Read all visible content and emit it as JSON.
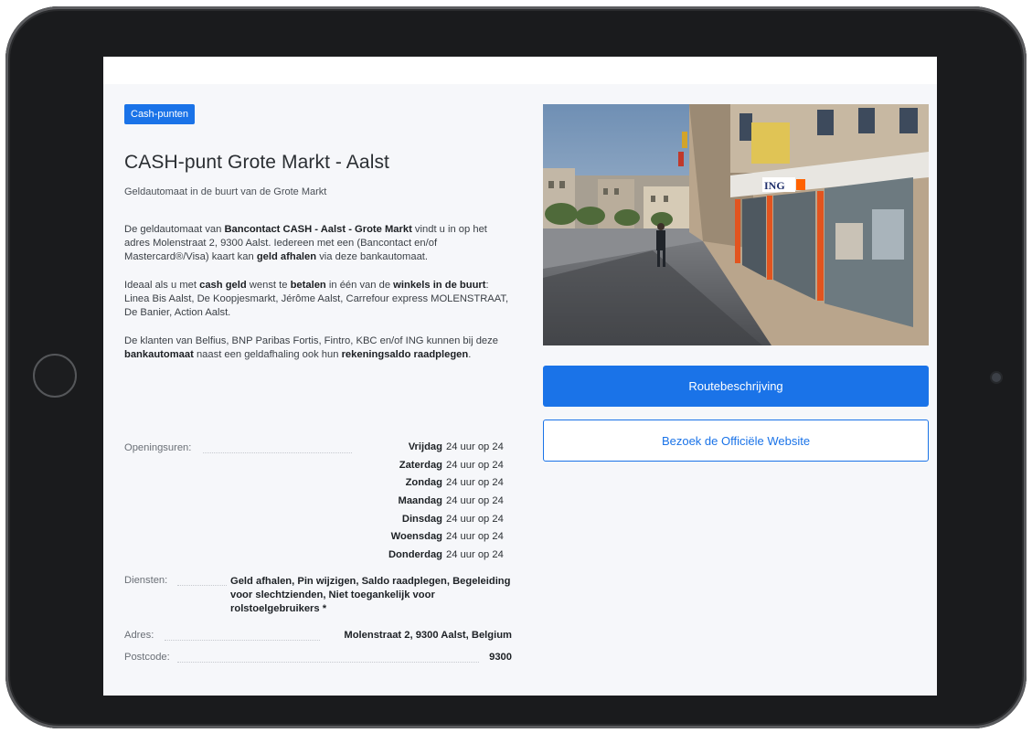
{
  "category_badge": "Cash-punten",
  "title": "CASH-punt Grote Markt - Aalst",
  "subtitle": "Geldautomaat in de buurt van de Grote Markt",
  "paragraphs": {
    "p1": {
      "a": "De geldautomaat van ",
      "b1": "Bancontact CASH - Aalst - Grote Markt",
      "c": " vindt u in op het adres Molenstraat 2, 9300 Aalst. Iedereen met een (Bancontact en/of Mastercard®/Visa) kaart kan ",
      "b2": "geld afhalen",
      "d": " via deze bankautomaat."
    },
    "p2": {
      "a": "Ideaal als u met ",
      "b1": "cash geld",
      "c": " wenst te ",
      "b2": "betalen",
      "d": " in één van de ",
      "b3": "winkels in de buurt",
      "e": ": Linea Bis Aalst, De Koopjesmarkt, Jérôme Aalst, Carrefour express MOLENSTRAAT, De Banier, Action Aalst."
    },
    "p3": {
      "a": "De klanten van Belfius, BNP Paribas Fortis, Fintro, KBC en/of ING kunnen bij deze ",
      "b1": "bankautomaat",
      "c": " naast een geldafhaling ook hun ",
      "b2": "rekeningsaldo raadplegen",
      "d": "."
    }
  },
  "info": {
    "opening_label": "Openingsuren:",
    "hours": [
      {
        "day": "Vrijdag",
        "value": "24 uur op 24"
      },
      {
        "day": "Zaterdag",
        "value": "24 uur op 24"
      },
      {
        "day": "Zondag",
        "value": "24 uur op 24"
      },
      {
        "day": "Maandag",
        "value": "24 uur op 24"
      },
      {
        "day": "Dinsdag",
        "value": "24 uur op 24"
      },
      {
        "day": "Woensdag",
        "value": "24 uur op 24"
      },
      {
        "day": "Donderdag",
        "value": "24 uur op 24"
      }
    ],
    "services_label": "Diensten:",
    "services_value": "Geld afhalen, Pin wijzigen, Saldo raadplegen, Begeleiding voor slechtzienden, Niet toegankelijk voor rolstoelgebruikers *",
    "address_label": "Adres:",
    "address_value": "Molenstraat 2, 9300 Aalst, Belgium",
    "postcode_label": "Postcode:",
    "postcode_value": "9300"
  },
  "photo": {
    "bank_sign": "ING"
  },
  "buttons": {
    "route": "Routebeschrijving",
    "website": "Bezoek de Officiële Website"
  },
  "colors": {
    "accent": "#1a73e8",
    "screen_bg": "#f6f7fa",
    "device": "#1a1b1d"
  }
}
